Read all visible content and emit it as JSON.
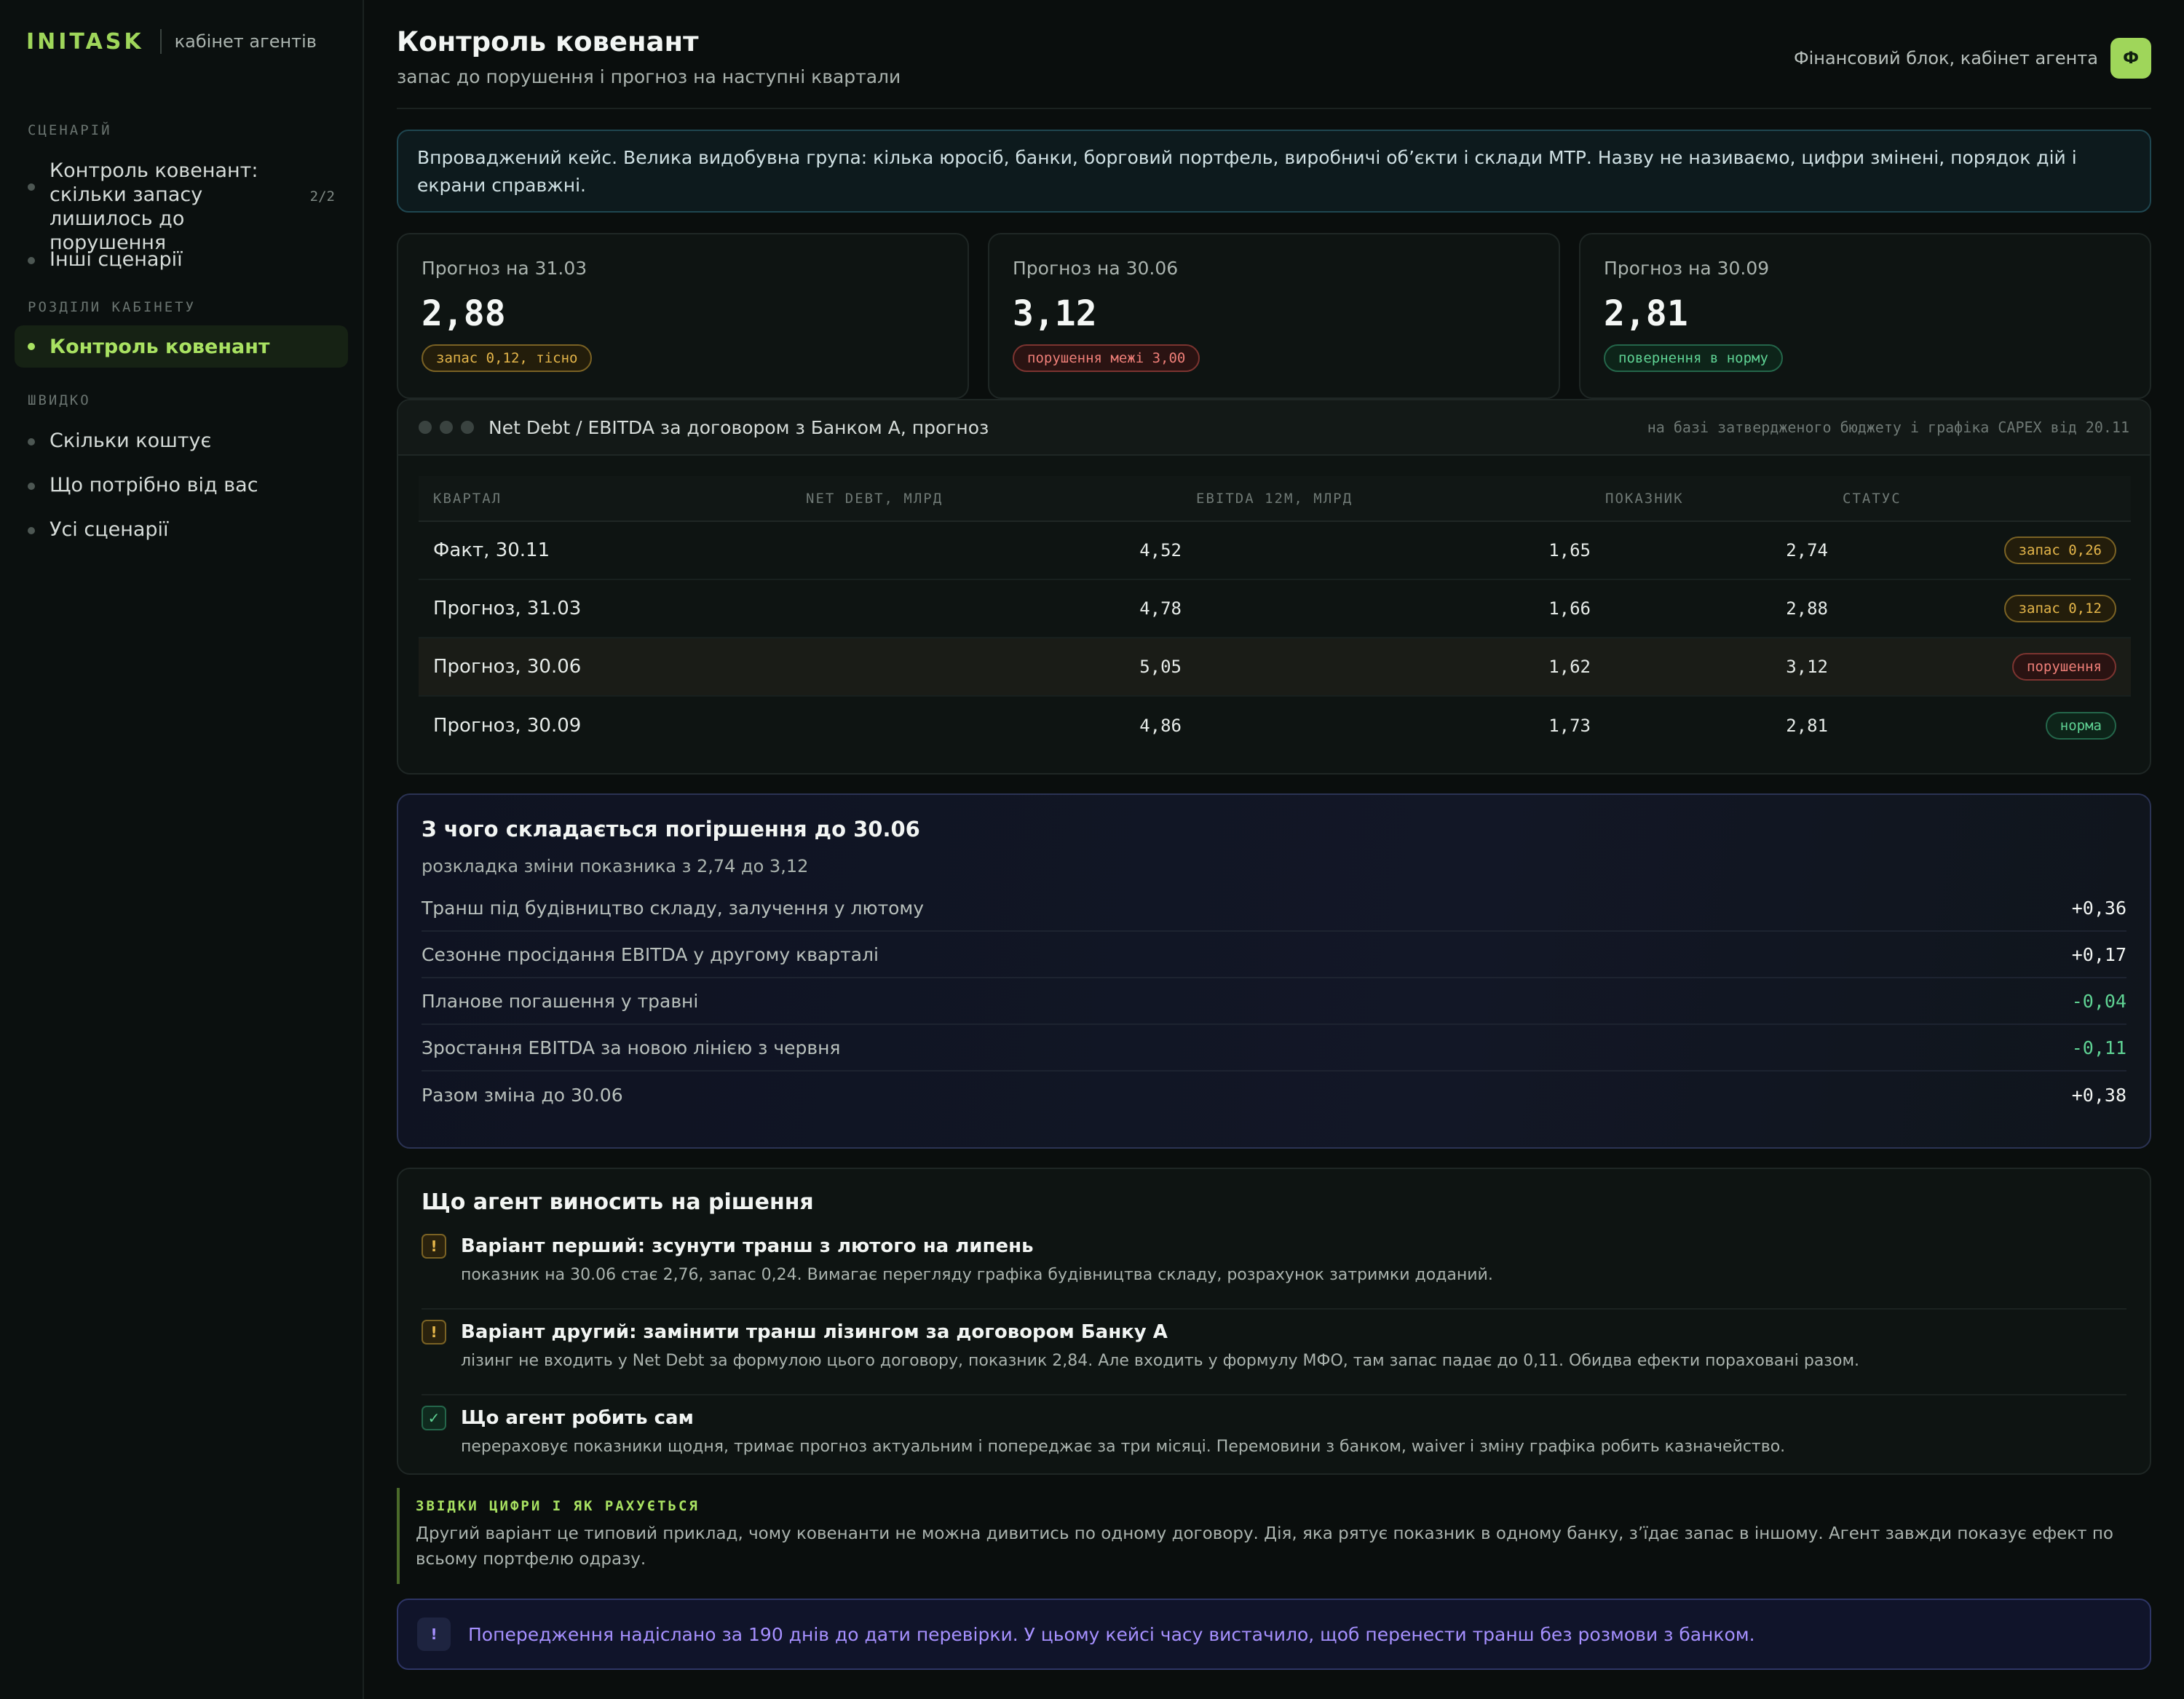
{
  "brand": {
    "name": "INITASK",
    "sub": "кабінет агентів"
  },
  "sidebar": {
    "sections": [
      {
        "label": "СЦЕНАРІЙ"
      },
      {
        "label": "РОЗДІЛИ КАБІНЕТУ"
      },
      {
        "label": "ШВИДКО"
      }
    ],
    "scenario_items": [
      {
        "label": "Контроль ковенант: скільки запасу лишилось до порушення",
        "count": "2/2"
      },
      {
        "label": "Інші сценарії"
      }
    ],
    "cabinet_items": [
      {
        "label": "Контроль ковенант",
        "active": true
      }
    ],
    "quick_items": [
      {
        "label": "Скільки коштує"
      },
      {
        "label": "Що потрібно від вас"
      },
      {
        "label": "Усі сценарії"
      }
    ]
  },
  "header": {
    "title": "Контроль ковенант",
    "subtitle": "запас до порушення і прогноз на наступні квартали",
    "context_label": "Фінансовий блок, кабінет агента",
    "avatar_letter": "Ф"
  },
  "intro": "Впроваджений кейс. Велика видобувна група: кілька юросіб, банки, борговий портфель, виробничі об’єкти і склади МТР. Назву не називаємо, цифри змінені, порядок дій і екрани справжні.",
  "kpis": [
    {
      "label": "Прогноз на 31.03",
      "value": "2,88",
      "badge": "запас 0,12, тісно",
      "tone": "warn"
    },
    {
      "label": "Прогноз на 30.06",
      "value": "3,12",
      "badge": "порушення межі 3,00",
      "tone": "bad"
    },
    {
      "label": "Прогноз на 30.09",
      "value": "2,81",
      "badge": "повернення в норму",
      "tone": "ok"
    }
  ],
  "table": {
    "title": "Net Debt / EBITDA за договором з Банком А, прогноз",
    "note": "на базі затвердженого бюджету і графіка CAPEX від 20.11",
    "columns": [
      "КВАРТАЛ",
      "NET DEBT, МЛРД",
      "EBITDA 12М, МЛРД",
      "ПОКАЗНИК",
      "СТАТУС"
    ],
    "rows": [
      {
        "quarter": "Факт, 30.11",
        "net_debt": "4,52",
        "ebitda": "1,65",
        "ratio": "2,74",
        "status": "запас 0,26",
        "tone": "warn"
      },
      {
        "quarter": "Прогноз, 31.03",
        "net_debt": "4,78",
        "ebitda": "1,66",
        "ratio": "2,88",
        "status": "запас 0,12",
        "tone": "warn"
      },
      {
        "quarter": "Прогноз, 30.06",
        "net_debt": "5,05",
        "ebitda": "1,62",
        "ratio": "3,12",
        "status": "порушення",
        "tone": "bad"
      },
      {
        "quarter": "Прогноз, 30.09",
        "net_debt": "4,86",
        "ebitda": "1,73",
        "ratio": "2,81",
        "status": "норма",
        "tone": "ok"
      }
    ]
  },
  "breakdown": {
    "title": "З чого складається погіршення до 30.06",
    "subtitle": "розкладка зміни показника з 2,74 до 3,12",
    "rows": [
      {
        "label": "Транш під будівництво складу, залучення у лютому",
        "value": "+0,36",
        "tone": "pos"
      },
      {
        "label": "Сезонне просідання EBITDA у другому кварталі",
        "value": "+0,17",
        "tone": "pos"
      },
      {
        "label": "Планове погашення у травні",
        "value": "-0,04",
        "tone": "neg"
      },
      {
        "label": "Зростання EBITDA за новою лінією з червня",
        "value": "-0,11",
        "tone": "neg"
      },
      {
        "label": "Разом зміна до 30.06",
        "value": "+0,38",
        "tone": "pos"
      }
    ]
  },
  "decision": {
    "title": "Що агент виносить на рішення",
    "items": [
      {
        "icon": "!",
        "tone": "warn",
        "head": "Варіант перший: зсунути транш з лютого на липень",
        "body": "показник на 30.06 стає 2,76, запас 0,24. Вимагає перегляду графіка будівництва складу, розрахунок затримки доданий."
      },
      {
        "icon": "!",
        "tone": "warn",
        "head": "Варіант другий: замінити транш лізингом за договором Банку А",
        "body": "лізинг не входить у Net Debt за формулою цього договору, показник 2,84. Але входить у формулу МФО, там запас падає до 0,11. Обидва ефекти пораховані разом."
      },
      {
        "icon": "✓",
        "tone": "ok",
        "head": "Що агент робить сам",
        "body": "перераховує показники щодня, тримає прогноз актуальним і попереджає за три місяці. Перемовини з банком, waiver і зміну графіка робить казначейство."
      }
    ]
  },
  "note": {
    "label": "ЗВІДКИ ЦИФРИ І ЯК РАХУЄТЬСЯ",
    "text": "Другий варіант це типовий приклад, чому ковенанти не можна дивитись по одному договору. Дія, яка рятує показник в одному банку, з’їдає запас в іншому. Агент завжди показує ефект по всьому портфелю одразу."
  },
  "alert": {
    "icon": "!",
    "text": "Попередження надіслано за 190 днів до дати перевірки. У цьому кейсі часу вистачило, щоб перенести транш без розмови з банком."
  }
}
